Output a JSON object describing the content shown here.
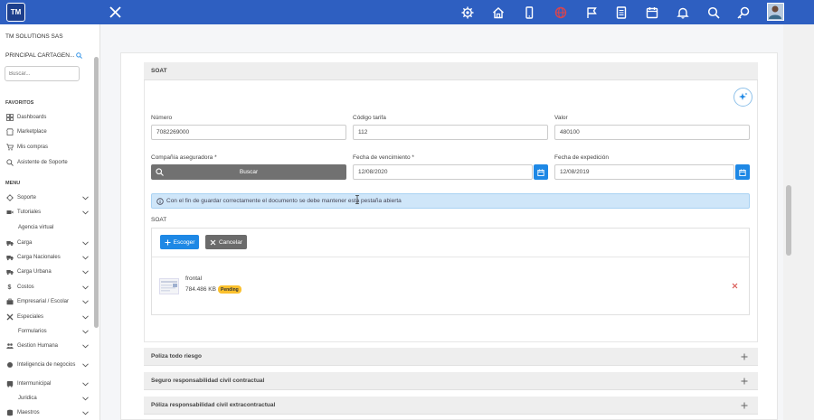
{
  "topbar": {
    "logo_text": "TM",
    "accent": "#2e5fc1",
    "icons": [
      "gear-icon",
      "home-icon",
      "phone-icon",
      "globe-icon",
      "flag-icon",
      "document-icon",
      "calendar-icon",
      "bell-icon",
      "search-icon",
      "key-search-icon"
    ]
  },
  "sidebar": {
    "company": "TM SOLUTIONS SAS",
    "branch": "PRINCIPAL CARTAGEN...",
    "search_placeholder": "Buscar...",
    "favoritos_title": "FAVORITOS",
    "menu_title": "MENU",
    "favorites": [
      {
        "label": "Dashboards",
        "icon": "dashboard-icon"
      },
      {
        "label": "Marketplace",
        "icon": "store-icon"
      },
      {
        "label": "Mis compras",
        "icon": "cart-icon"
      },
      {
        "label": "Asistente de Soporte",
        "icon": "search-icon"
      }
    ],
    "menu": [
      {
        "label": "Soporte",
        "icon": "gear-icon"
      },
      {
        "label": "Tutoriales",
        "icon": "video-icon"
      },
      {
        "label": "Agencia virtual",
        "icon": ""
      },
      {
        "label": "Carga",
        "icon": "truck-icon"
      },
      {
        "label": "Carga Nacionales",
        "icon": "truck-icon"
      },
      {
        "label": "Carga Urbana",
        "icon": "truck-icon"
      },
      {
        "label": "Costos",
        "icon": "dollar-icon"
      },
      {
        "label": "Empresarial / Escolar",
        "icon": "briefcase-icon"
      },
      {
        "label": "Especiales",
        "icon": "tools-icon"
      },
      {
        "label": "Formularios",
        "icon": ""
      },
      {
        "label": "Gestion Humana",
        "icon": "people-icon"
      },
      {
        "label": "Inteligencia de negocios",
        "icon": "brain-icon"
      },
      {
        "label": "Intermunicipal",
        "icon": "bus-icon"
      },
      {
        "label": "Juridica",
        "icon": ""
      },
      {
        "label": "Maestros",
        "icon": "database-icon"
      }
    ]
  },
  "main": {
    "section_title": "SOAT",
    "fields": {
      "numero_label": "Número",
      "numero_value": "7082269000",
      "codigo_label": "Código tarifa",
      "codigo_value": "112",
      "valor_label": "Valor",
      "valor_value": "480100",
      "compania_label": "Compañía aseguradora *",
      "buscar_label": "Buscar",
      "vencimiento_label": "Fecha de vencimiento *",
      "vencimiento_value": "12/08/2020",
      "expedicion_label": "Fecha de expedición",
      "expedicion_value": "12/08/2019"
    },
    "info_message": "Con el fin de guardar correctamente el documento se debe mantener esta pestaña abierta",
    "upload": {
      "label": "SOAT",
      "choose_label": "Escoger",
      "cancel_label": "Cancelar",
      "file_name": "frontal",
      "file_size": "784.486 KB",
      "status": "Pending"
    },
    "collapsed_sections": [
      "Poliza todo riesgo",
      "Seguro responsabilidad civil contractual",
      "Póliza responsabilidad civil extracontractual"
    ]
  }
}
